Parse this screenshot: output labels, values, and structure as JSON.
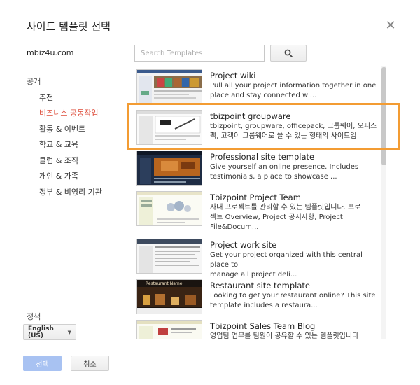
{
  "dialog": {
    "title": "사이트 템플릿 선택",
    "site_name": "mbiz4u.com",
    "search": {
      "placeholder": "Search Templates"
    },
    "close_icon": "close-icon",
    "accent_color": "#dd4b39",
    "highlight_color": "#f39c33"
  },
  "categories": {
    "header": "공개",
    "items": [
      {
        "label": "추천",
        "active": false
      },
      {
        "label": "비즈니스 공동작업",
        "active": true
      },
      {
        "label": "활동 & 이벤트",
        "active": false
      },
      {
        "label": "학교 & 교육",
        "active": false
      },
      {
        "label": "클럽 & 조직",
        "active": false
      },
      {
        "label": "개인 & 가족",
        "active": false
      },
      {
        "label": "정부 & 비영리 기관",
        "active": false
      }
    ]
  },
  "policy": {
    "header": "정책",
    "language": "English (US)"
  },
  "templates": [
    {
      "title": "Project wiki",
      "line1": "Pull all your project information together in one",
      "line2": "place and stay connected wi..."
    },
    {
      "title": "tbizpoint groupware",
      "line1": "tbizpoint, groupware, officepack, 그룹웨어, 오피스",
      "line2": "팩, 고객이 그룹웨어로 쓸 수 있는 형태의 사이트임"
    },
    {
      "title": "Professional site template",
      "line1": "Give yourself an online presence. Includes",
      "line2": "testimonials, a place to showcase ..."
    },
    {
      "title": "Tbizpoint Project Team",
      "line1": "사내 프로젝트를 관리할 수 있는 템플릿입니다. 프로",
      "line2": "젝트 Overview, Project 공지사항, Project",
      "line3": "File&Docum..."
    },
    {
      "title": "Project work site",
      "line1": "Get your project organized with this central place to",
      "line2": "manage all project deli..."
    },
    {
      "title": "Restaurant site template",
      "line1": "Looking to get your restaurant online? This site",
      "line2": "template includes a restaura...",
      "thumb_text": "Restaurant Name"
    },
    {
      "title": "Tbizpoint Sales Team Blog",
      "line1": "영업팀 업무를 팀원이 공유할 수 있는 템플릿입니다"
    }
  ],
  "buttons": {
    "select": "선택",
    "cancel": "취소"
  }
}
